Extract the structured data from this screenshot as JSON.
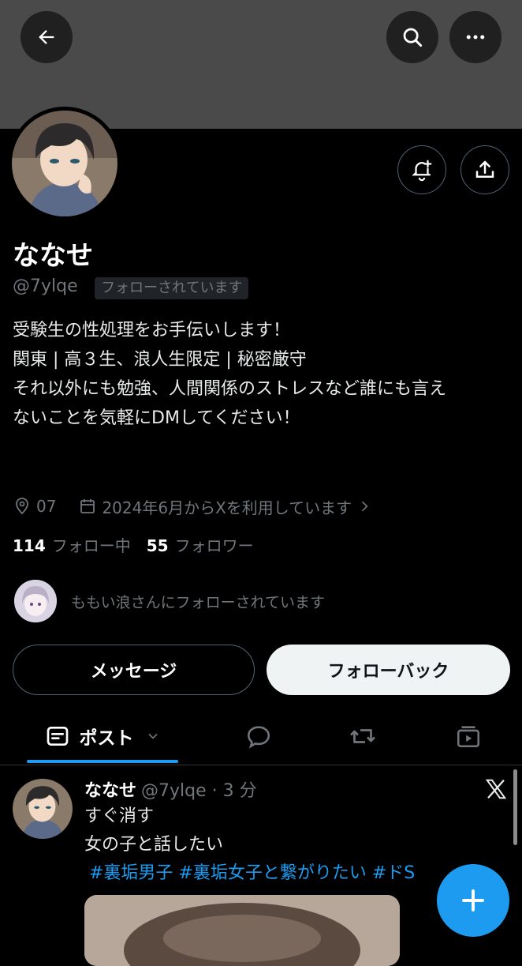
{
  "profile": {
    "name": "ななせ",
    "handle": "@7ylqe",
    "follows_you": "フォローされています",
    "bio_lines": [
      "受験生の性処理をお手伝いします！",
      "",
      "関東 | 高３生、浪人生限定 | 秘密厳守",
      "",
      "それ以外にも勉強、人間関係のストレスなど誰にも言え",
      "ないことを気軽にDMしてください！"
    ],
    "location": "07",
    "joined": "2024年6月からXを利用しています",
    "following_count": "114",
    "following_label": "フォロー中",
    "followers_count": "55",
    "followers_label": "フォロワー",
    "followed_by_text": "ももい浪さんにフォローされています"
  },
  "actions": {
    "message_label": "メッセージ",
    "follow_back_label": "フォローバック"
  },
  "tabs": {
    "posts_label": "ポスト"
  },
  "tweet": {
    "name": "ななせ",
    "handle_time": "@7ylqe · 3 分",
    "line1": "すぐ消す",
    "line2": "女の子と話したい",
    "hashtags": "#裏垢男子 #裏垢女子と繋がりたい #ドS"
  },
  "icons": [
    "back-arrow-icon",
    "search-icon",
    "more-icon",
    "notify-plus-icon",
    "share-icon",
    "location-icon",
    "calendar-icon",
    "chevron-right-icon",
    "posts-icon",
    "chevron-down-icon",
    "reply-icon",
    "repost-icon",
    "media-icon",
    "x-logo-icon",
    "plus-icon"
  ],
  "colors": {
    "accent": "#1d9bf0",
    "background": "#000000",
    "banner": "#4a4a4a",
    "muted_text": "#71767b"
  }
}
